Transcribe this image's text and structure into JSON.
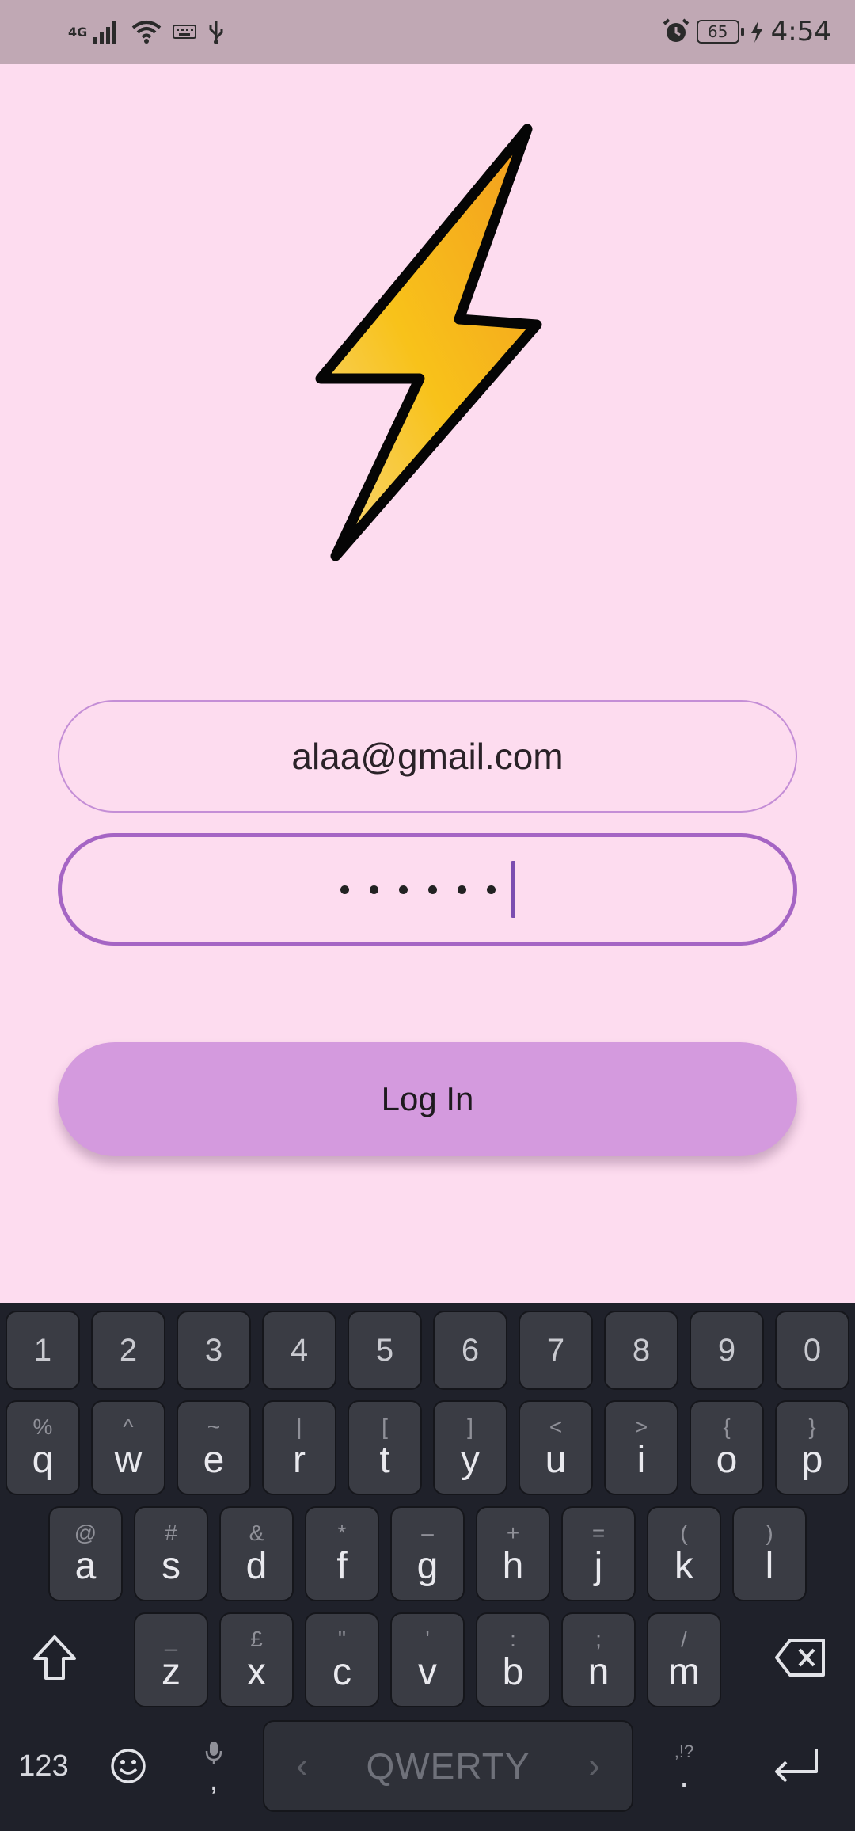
{
  "status_bar": {
    "network": "4G",
    "battery": "65",
    "time": "4:54",
    "icons": [
      "signal-icon",
      "wifi-icon",
      "keyboard-icon",
      "usb-icon",
      "alarm-icon",
      "battery-icon",
      "charging-icon"
    ]
  },
  "form": {
    "email_value": "alaa@gmail.com",
    "password_masked_length": 6
  },
  "login_button": {
    "label": "Log In"
  },
  "colors": {
    "background": "#fddcef",
    "status_bar": "#c0a8b4",
    "accent": "#a565c4",
    "button": "#d49ade",
    "keyboard_bg": "#1f212a",
    "key_bg": "#3a3c44"
  },
  "keyboard": {
    "number_row": [
      "1",
      "2",
      "3",
      "4",
      "5",
      "6",
      "7",
      "8",
      "9",
      "0"
    ],
    "row1": [
      {
        "main": "q",
        "alt": "%"
      },
      {
        "main": "w",
        "alt": "^"
      },
      {
        "main": "e",
        "alt": "~"
      },
      {
        "main": "r",
        "alt": "|"
      },
      {
        "main": "t",
        "alt": "["
      },
      {
        "main": "y",
        "alt": "]"
      },
      {
        "main": "u",
        "alt": "<"
      },
      {
        "main": "i",
        "alt": ">"
      },
      {
        "main": "o",
        "alt": "{"
      },
      {
        "main": "p",
        "alt": "}"
      }
    ],
    "row2": [
      {
        "main": "a",
        "alt": "@"
      },
      {
        "main": "s",
        "alt": "#"
      },
      {
        "main": "d",
        "alt": "&"
      },
      {
        "main": "f",
        "alt": "*"
      },
      {
        "main": "g",
        "alt": "–"
      },
      {
        "main": "h",
        "alt": "+"
      },
      {
        "main": "j",
        "alt": "="
      },
      {
        "main": "k",
        "alt": "("
      },
      {
        "main": "l",
        "alt": ")"
      }
    ],
    "row3": [
      {
        "main": "z",
        "alt": "_"
      },
      {
        "main": "x",
        "alt": "£"
      },
      {
        "main": "c",
        "alt": "\""
      },
      {
        "main": "v",
        "alt": "'"
      },
      {
        "main": "b",
        "alt": ":"
      },
      {
        "main": "n",
        "alt": ";"
      },
      {
        "main": "m",
        "alt": "/"
      }
    ],
    "mode_key": "123",
    "comma_key": ",",
    "space_label": "QWERTY",
    "period_key": ".",
    "period_alt": ",!?"
  }
}
